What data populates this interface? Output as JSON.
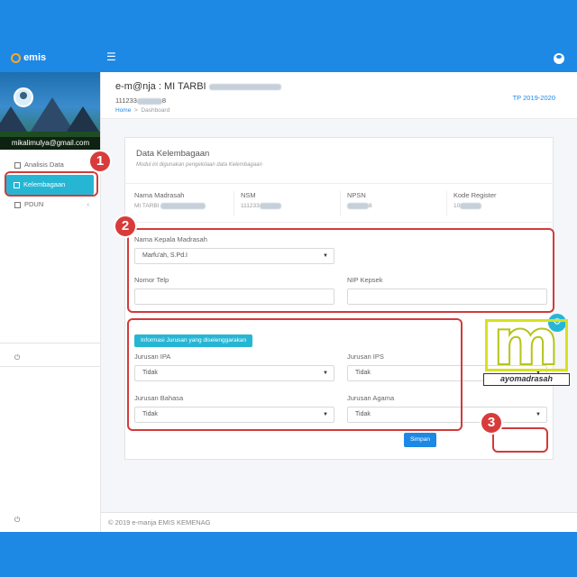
{
  "app": {
    "logo_text": "emis"
  },
  "sidebar": {
    "email": "mikalimulya@gmail.com",
    "items": [
      {
        "label": "Analisis Data"
      },
      {
        "label": "Kelembagaan"
      },
      {
        "label": "PDUN"
      }
    ]
  },
  "header": {
    "school_title": "e-m@nja : MI TARBI",
    "nsm": "111233",
    "nsm_suffix": "8",
    "breadcrumb_home": "Home",
    "breadcrumb_sep": ">",
    "breadcrumb_current": "Dashboard",
    "tp": "TP 2019-2020"
  },
  "card": {
    "title": "Data Kelembagaan",
    "subtitle": "Modul ini digunakan pengelolaan data Kelembagaan",
    "info": [
      {
        "label": "Nama Madrasah",
        "value": "MI TARBI"
      },
      {
        "label": "NSM",
        "value": "111233"
      },
      {
        "label": "NPSN",
        "value": "8"
      },
      {
        "label": "Kode Register",
        "value": "10"
      }
    ],
    "kepala_label": "Nama Kepala Madrasah",
    "kepala_value": "Marfu'ah, S.Pd.I",
    "telp_label": "Nomor Telp",
    "telp_value": "",
    "nip_label": "NIP Kepsek",
    "nip_value": "",
    "jurusan_pill": "Informasi Jurusan yang diselenggarakan",
    "jurusan": [
      {
        "label": "Jurusan IPA",
        "value": "Tidak"
      },
      {
        "label": "Jurusan IPS",
        "value": "Tidak"
      },
      {
        "label": "Jurusan Bahasa",
        "value": "Tidak"
      },
      {
        "label": "Jurusan Agama",
        "value": "Tidak"
      }
    ],
    "save_label": "Simpan"
  },
  "annotations": {
    "one": "1",
    "two": "2",
    "three": "3"
  },
  "watermark": {
    "text": "ayomadrasah"
  },
  "footer": {
    "copyright": "© 2019 e-manja EMIS KEMENAG"
  },
  "colors": {
    "primary": "#1e88e5",
    "accent": "#26b6d4",
    "annotation": "#d13b3b"
  }
}
